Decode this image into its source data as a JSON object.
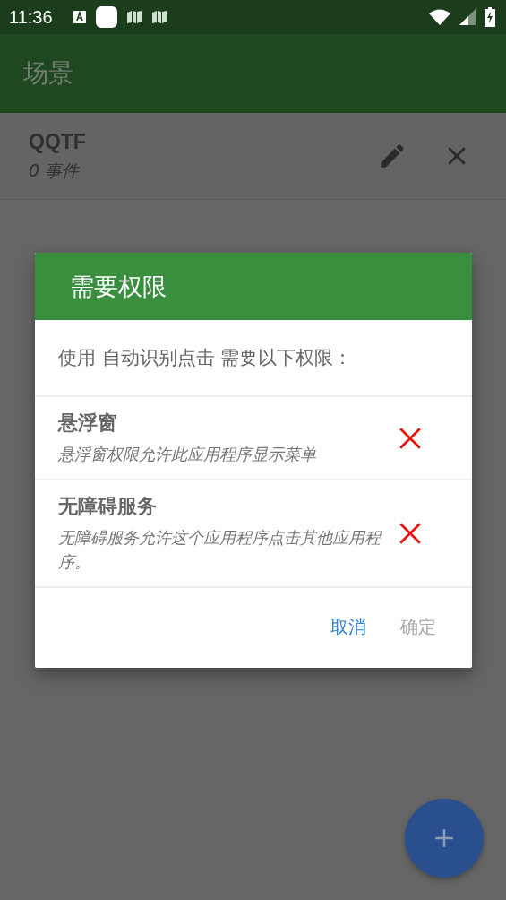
{
  "status_bar": {
    "time": "11:36"
  },
  "app_bar": {
    "title": "场景"
  },
  "scenes": [
    {
      "name": "QQTF",
      "events": "0 事件"
    }
  ],
  "dialog": {
    "title": "需要权限",
    "intro": "使用 自动识别点击 需要以下权限：",
    "permissions": [
      {
        "name": "悬浮窗",
        "description": "悬浮窗权限允许此应用程序显示菜单",
        "granted": false
      },
      {
        "name": "无障碍服务",
        "description": "无障碍服务允许这个应用程序点击其他应用程序。",
        "granted": false
      }
    ],
    "buttons": [
      {
        "label": "取消",
        "disabled": false
      },
      {
        "label": "确定",
        "disabled": true
      }
    ]
  }
}
